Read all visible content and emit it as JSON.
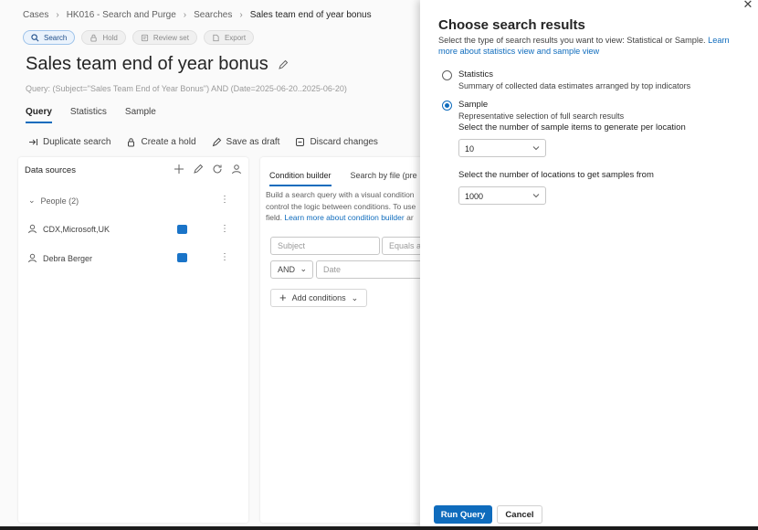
{
  "breadcrumb": {
    "items": [
      "Cases",
      "HK016 - Search and Purge",
      "Searches",
      "Sales team end of year bonus"
    ]
  },
  "pills": {
    "search": "Search",
    "hold": "Hold",
    "review_set": "Review set",
    "export": "Export"
  },
  "page": {
    "title": "Sales team end of year bonus",
    "query": "Query: (Subject=\"Sales Team End of Year Bonus\") AND (Date=2025-06-20..2025-06-20)"
  },
  "tabs": [
    "Query",
    "Statistics",
    "Sample"
  ],
  "toolbar": {
    "duplicate": "Duplicate search",
    "hold": "Create a hold",
    "draft": "Save as draft",
    "discard": "Discard changes"
  },
  "data_sources": {
    "title": "Data sources",
    "group": "People (2)",
    "items": [
      "CDX,Microsoft,UK",
      "Debra Berger"
    ]
  },
  "condition": {
    "tabs": [
      "Condition builder",
      "Search by file (pre"
    ],
    "desc_line1": "Build a search query with a visual condition",
    "desc_line2": "control the logic between conditions. To use",
    "desc_line3_field": "field.",
    "desc_line3_link": "Learn more about condition builder",
    "desc_line3_tail": "ar",
    "subject_placeholder": "Subject",
    "equals_placeholder": "Equals an",
    "and_label": "AND",
    "date_placeholder": "Date",
    "add_conditions": "Add conditions"
  },
  "panel": {
    "title": "Choose search results",
    "desc": "Select the type of search results you want to view: Statistical or Sample.",
    "desc_link": "Learn more about statistics view and sample view",
    "statistics_label": "Statistics",
    "statistics_desc": "Summary of collected data estimates arranged by top indicators",
    "sample_label": "Sample",
    "sample_desc": "Representative selection of full search results",
    "items_question": "Select the number of sample items to generate per location",
    "items_value": "10",
    "locations_question": "Select the number of locations to get samples from",
    "locations_value": "1000",
    "selected": "sample",
    "run_label": "Run Query",
    "cancel_label": "Cancel"
  },
  "colors": {
    "accent": "#0f6cbd",
    "outlook_badge": "#1a74c8"
  }
}
